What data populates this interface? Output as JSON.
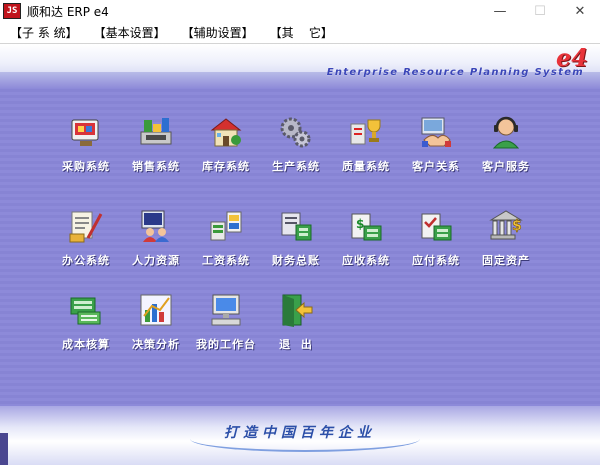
{
  "window": {
    "logo_text": "JS",
    "title": "顺和达 ERP e4",
    "minimize_glyph": "—",
    "maximize_glyph": "☐",
    "close_glyph": "✕"
  },
  "menu": [
    {
      "label": "【子 系 统】"
    },
    {
      "label": "【基本设置】"
    },
    {
      "label": "【辅助设置】"
    },
    {
      "label": "【其    它】"
    }
  ],
  "header": {
    "brand": "e4",
    "banner": "Enterprise Resource Planning System"
  },
  "modules": [
    {
      "label": "采购系统",
      "icon": "purchase-icon"
    },
    {
      "label": "销售系统",
      "icon": "sales-icon"
    },
    {
      "label": "库存系统",
      "icon": "inventory-icon"
    },
    {
      "label": "生产系统",
      "icon": "production-gears-icon"
    },
    {
      "label": "质量系统",
      "icon": "quality-trophy-icon"
    },
    {
      "label": "客户关系",
      "icon": "handshake-icon"
    },
    {
      "label": "客户服务",
      "icon": "customer-service-icon"
    },
    {
      "label": "办公系统",
      "icon": "office-document-icon"
    },
    {
      "label": "人力资源",
      "icon": "human-resources-icon"
    },
    {
      "label": "工资系统",
      "icon": "payroll-icon"
    },
    {
      "label": "财务总账",
      "icon": "ledger-icon"
    },
    {
      "label": "应收系统",
      "icon": "receivables-icon"
    },
    {
      "label": "应付系统",
      "icon": "payables-icon"
    },
    {
      "label": "固定资产",
      "icon": "fixed-assets-icon"
    },
    {
      "label": "成本核算",
      "icon": "cost-accounting-icon"
    },
    {
      "label": "决策分析",
      "icon": "decision-chart-icon"
    },
    {
      "label": "我的工作台",
      "icon": "workstation-computer-icon"
    },
    {
      "label": "退  出",
      "icon": "exit-door-icon"
    }
  ],
  "footer": {
    "slogan": "打造中国百年企业"
  }
}
